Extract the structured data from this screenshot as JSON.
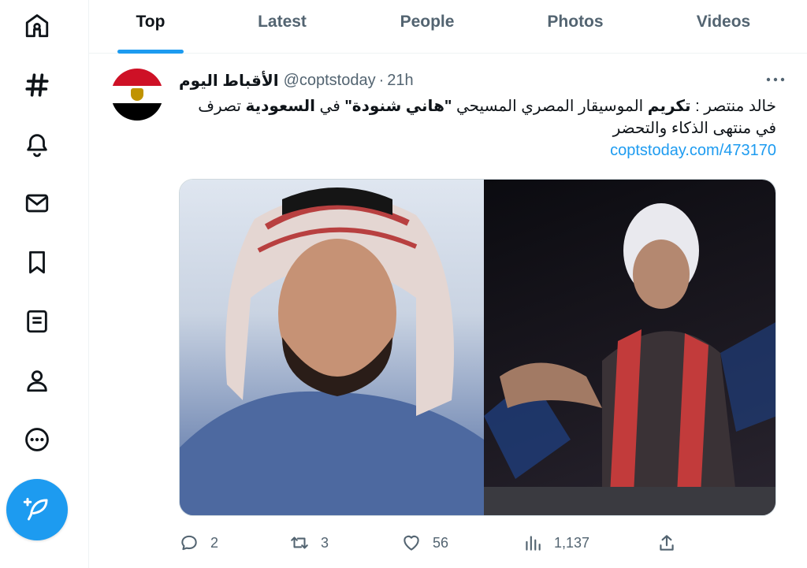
{
  "nav": {
    "items": [
      {
        "icon": "home-icon"
      },
      {
        "icon": "explore-hashtag-icon"
      },
      {
        "icon": "notifications-bell-icon"
      },
      {
        "icon": "messages-envelope-icon"
      },
      {
        "icon": "bookmarks-icon"
      },
      {
        "icon": "lists-icon"
      },
      {
        "icon": "profile-person-icon"
      },
      {
        "icon": "more-circle-icon"
      }
    ],
    "compose_icon": "compose-feather-icon"
  },
  "tabs": [
    {
      "label": "Top",
      "active": true
    },
    {
      "label": "Latest",
      "active": false
    },
    {
      "label": "People",
      "active": false
    },
    {
      "label": "Photos",
      "active": false
    },
    {
      "label": "Videos",
      "active": false
    }
  ],
  "tweet": {
    "author_name": "الأقباط اليوم",
    "handle": "@coptstoday",
    "separator": "·",
    "time": "21h",
    "text_part1": "خالد منتصر : ",
    "text_bold1": "تكريم",
    "text_part2": " الموسيقار المصري المسيحي ",
    "text_bold2": "\"هاني شنودة\"",
    "text_part3": " في ",
    "text_bold3": "السعودية",
    "text_part4": " تصرف في منتهى الذكاء والتحضر",
    "link": "coptstoday.com/473170",
    "actions": {
      "replies": "2",
      "retweets": "3",
      "likes": "56",
      "views": "1,137"
    }
  },
  "colors": {
    "accent": "#1d9bf0",
    "text_primary": "#0f1419",
    "text_secondary": "#536471"
  }
}
